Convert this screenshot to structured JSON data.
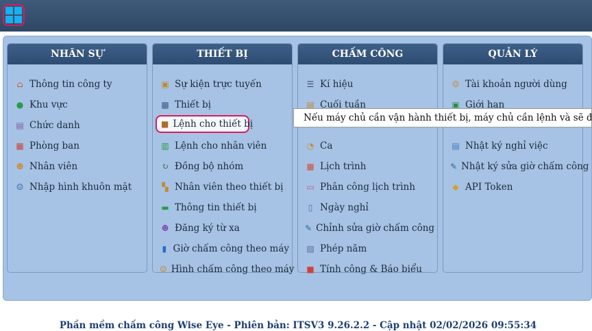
{
  "columns": [
    {
      "title": "NHÂN SỰ",
      "items": [
        {
          "label": "Thông tin công ty",
          "icon": "house-icon"
        },
        {
          "label": "Khu vực",
          "icon": "location-pin-icon"
        },
        {
          "label": "Chức danh",
          "icon": "id-badge-icon"
        },
        {
          "label": "Phòng ban",
          "icon": "org-chart-icon"
        },
        {
          "label": "Nhân viên",
          "icon": "group-icon"
        },
        {
          "label": "Nhập hình khuôn mặt",
          "icon": "user-icon"
        }
      ]
    },
    {
      "title": "THIẾT BỊ",
      "items": [
        {
          "label": "Sự kiện trực tuyến",
          "icon": "online-event-icon"
        },
        {
          "label": "Thiết bị",
          "icon": "device-icon"
        },
        {
          "label": "Lệnh cho thiết bị",
          "icon": "box-icon"
        },
        {
          "label": "Lệnh cho nhân viên",
          "icon": "employee-command-icon"
        },
        {
          "label": "Đồng bộ nhóm",
          "icon": "sync-icon"
        },
        {
          "label": "Nhân viên theo thiết bị",
          "icon": "employee-device-icon"
        },
        {
          "label": "Thông tin thiết bị",
          "icon": "device-info-icon"
        },
        {
          "label": "Đăng ký từ xa",
          "icon": "remote-register-icon"
        },
        {
          "label": "Giờ chấm công theo máy",
          "icon": "document-icon"
        },
        {
          "label": "Hình chấm công theo máy",
          "icon": "photo-user-icon"
        }
      ]
    },
    {
      "title": "CHẤM CÔNG",
      "items": [
        {
          "label": "Kí hiệu",
          "icon": "list-icon"
        },
        {
          "label": "Cuối tuần",
          "icon": "clipboard-icon"
        },
        {
          "label": "",
          "icon": ""
        },
        {
          "label": "Ca",
          "icon": "clock-icon"
        },
        {
          "label": "Lịch trình",
          "icon": "calendar-icon"
        },
        {
          "label": "Phân công lịch trình",
          "icon": "schedule-assign-icon"
        },
        {
          "label": "Ngày nghỉ",
          "icon": "day-off-icon"
        },
        {
          "label": "Chỉnh sửa giờ chấm công",
          "icon": "edit-icon"
        },
        {
          "label": "Phép năm",
          "icon": "annual-leave-icon"
        },
        {
          "label": "Tính công & Báo biểu",
          "icon": "report-icon"
        }
      ]
    },
    {
      "title": "QUẢN LÝ",
      "items": [
        {
          "label": "Tài khoản người dùng",
          "icon": "user-account-icon"
        },
        {
          "label": "Giới hạn",
          "icon": "limit-icon"
        },
        {
          "label": "",
          "icon": ""
        },
        {
          "label": "Nhật ký nghỉ việc",
          "icon": "resign-log-icon"
        },
        {
          "label": "Nhật ký sửa giờ chấm công",
          "icon": "edit-log-icon"
        },
        {
          "label": "API Token",
          "icon": "shield-icon"
        }
      ]
    }
  ],
  "tooltip": "Nếu máy chủ cần vận hành thiết bị, máy chủ cần lệnh và sẽ đợi cho đến khi",
  "footer": "Phần mềm chấm công Wise Eye - Phiên bản: ITSV3 9.26.2.2 - Cập nhật 02/02/2026 09:55:34",
  "colors": {
    "header": "#2e4c72",
    "panel": "#a6c2e4",
    "highlight": "#d81b60",
    "footer_text": "#1e3f72"
  }
}
